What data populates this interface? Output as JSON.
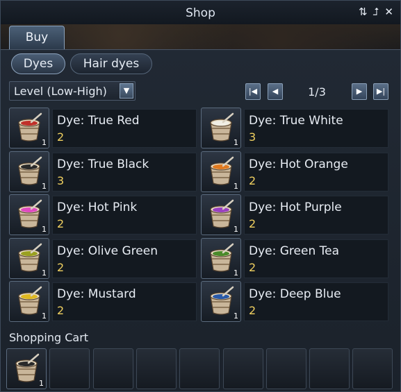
{
  "window": {
    "title": "Shop"
  },
  "titlebar_icons": [
    "refresh-icon",
    "collapse-icon",
    "close-icon"
  ],
  "tabs": [
    {
      "label": "Buy",
      "active": true
    }
  ],
  "categories": [
    {
      "label": "Dyes",
      "active": true
    },
    {
      "label": "Hair dyes",
      "active": false
    }
  ],
  "sort": {
    "selected": "Level (Low-High)"
  },
  "pagination": {
    "page": "1/3"
  },
  "items": [
    {
      "name": "Dye: True Red",
      "price": "2",
      "qty": "1",
      "color": "#c0302a"
    },
    {
      "name": "Dye: True White",
      "price": "3",
      "qty": "1",
      "color": "#f0eee4"
    },
    {
      "name": "Dye: True Black",
      "price": "3",
      "qty": "1",
      "color": "#2a2a2a"
    },
    {
      "name": "Dye: Hot Orange",
      "price": "2",
      "qty": "1",
      "color": "#e07a20"
    },
    {
      "name": "Dye: Hot Pink",
      "price": "2",
      "qty": "1",
      "color": "#e04ac0"
    },
    {
      "name": "Dye: Hot Purple",
      "price": "2",
      "qty": "1",
      "color": "#9a40c0"
    },
    {
      "name": "Dye: Olive Green",
      "price": "2",
      "qty": "1",
      "color": "#9aa020"
    },
    {
      "name": "Dye: Green Tea",
      "price": "2",
      "qty": "1",
      "color": "#4a8a2a"
    },
    {
      "name": "Dye: Mustard",
      "price": "2",
      "qty": "1",
      "color": "#e0b820"
    },
    {
      "name": "Dye: Deep Blue",
      "price": "2",
      "qty": "1",
      "color": "#2a5aa8"
    }
  ],
  "cart": {
    "title": "Shopping Cart",
    "items": [
      {
        "qty": "1",
        "color": "#2a2a2a"
      }
    ]
  }
}
